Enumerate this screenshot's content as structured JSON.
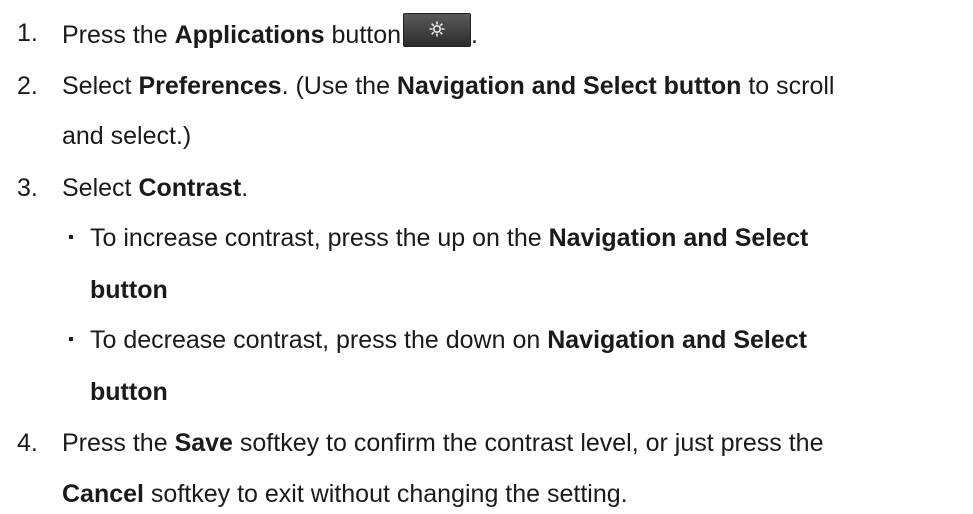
{
  "steps": [
    {
      "number": "1.",
      "lines": [
        {
          "parts": [
            "Press the ",
            "Applications",
            " button",
            "."
          ]
        }
      ],
      "icon": "gear-icon"
    },
    {
      "number": "2.",
      "lines": [
        {
          "parts": [
            "Select ",
            "Preferences",
            ". (Use the ",
            "Navigation and Select button",
            " to scroll"
          ]
        },
        {
          "parts": [
            "and select.)"
          ]
        }
      ]
    },
    {
      "number": "3.",
      "lines": [
        {
          "parts": [
            "Select ",
            "Contrast",
            "."
          ]
        }
      ],
      "bullets": [
        {
          "lines": [
            {
              "parts": [
                "To increase contrast, press the up on the ",
                "Navigation and Select"
              ]
            },
            {
              "parts": [
                "button"
              ]
            }
          ]
        },
        {
          "lines": [
            {
              "parts": [
                "To decrease contrast, press the down on ",
                "Navigation and Select"
              ]
            },
            {
              "parts": [
                "button"
              ]
            }
          ]
        }
      ]
    },
    {
      "number": "4.",
      "lines": [
        {
          "parts": [
            "Press the ",
            "Save",
            " softkey to confirm the contrast level, or just press the"
          ]
        },
        {
          "parts": [
            "Cancel",
            " softkey to exit without changing the setting."
          ]
        }
      ]
    }
  ],
  "bullet_char": "▪"
}
